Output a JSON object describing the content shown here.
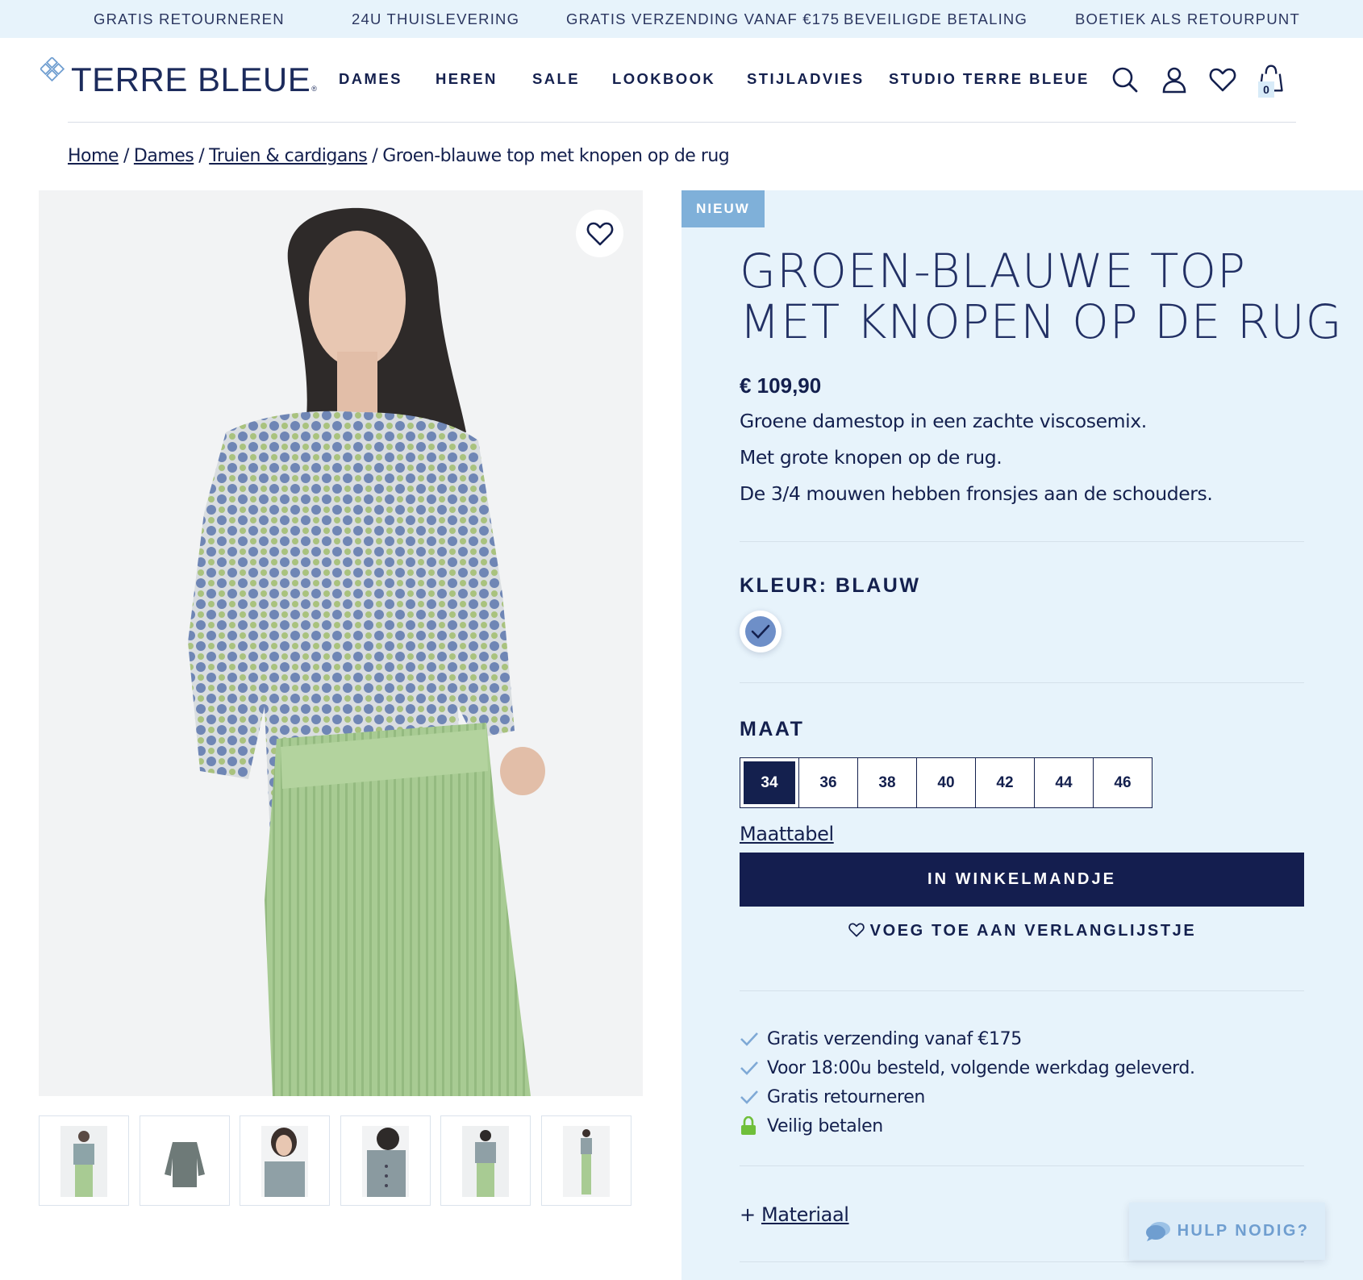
{
  "usp_bar": {
    "items": [
      "GRATIS RETOURNEREN",
      "24U THUISLEVERING",
      "GRATIS VERZENDING VANAF €175",
      "BEVEILIGDE BETALING",
      "BOETIEK ALS RETOURPUNT"
    ]
  },
  "header": {
    "logo_text": "TERRE BLEUE",
    "logo_mark": "®",
    "nav": [
      "DAMES",
      "HEREN",
      "SALE",
      "LOOKBOOK",
      "STIJLADVIES",
      "STUDIO TERRE BLEUE"
    ],
    "icons": [
      "search-icon",
      "account-icon",
      "heart-icon",
      "cart-icon"
    ],
    "cart_count": "0"
  },
  "breadcrumb": {
    "items": [
      "Home",
      "Dames",
      "Truien & cardigans"
    ],
    "current": "Groen-blauwe top met knopen op de rug",
    "separator": "/"
  },
  "product": {
    "badge": "NIEUW",
    "title_line1": "GROEN-BLAUWE TOP",
    "title_line2": "MET KNOPEN OP DE RUG",
    "price": "€ 109,90",
    "description": [
      "Groene damestop in een zachte viscosemix.",
      "Met grote knopen op de rug.",
      "De 3/4 mouwen hebben fronsjes aan de schouders."
    ],
    "color_label": "KLEUR: BLAUW",
    "color_swatch": "#6e8fc8",
    "size_label": "MAAT",
    "sizes": [
      "34",
      "36",
      "38",
      "40",
      "42",
      "44",
      "46"
    ],
    "selected_size": "34",
    "size_chart_link": "Maattabel",
    "add_to_cart": "IN WINKELMANDJE",
    "add_to_wishlist": "VOEG TOE AAN VERLANGLIJSTJE",
    "usps": [
      {
        "icon": "check-icon",
        "text": "Gratis verzending vanaf €175"
      },
      {
        "icon": "check-icon",
        "text": "Voor 18:00u besteld, volgende werkdag geleverd."
      },
      {
        "icon": "check-icon",
        "text": "Gratis retourneren"
      },
      {
        "icon": "lock-icon",
        "text": "Veilig betalen"
      }
    ],
    "material_prefix": "+",
    "material_label": "Materiaal"
  },
  "help": {
    "label": "HULP NODIG?"
  },
  "colors": {
    "navy": "#141e4f",
    "light_blue_bg": "#e7f3fb",
    "badge_blue": "#7fb0d9",
    "check_blue": "#7fa9d6",
    "lock_green": "#6fbf3a"
  }
}
